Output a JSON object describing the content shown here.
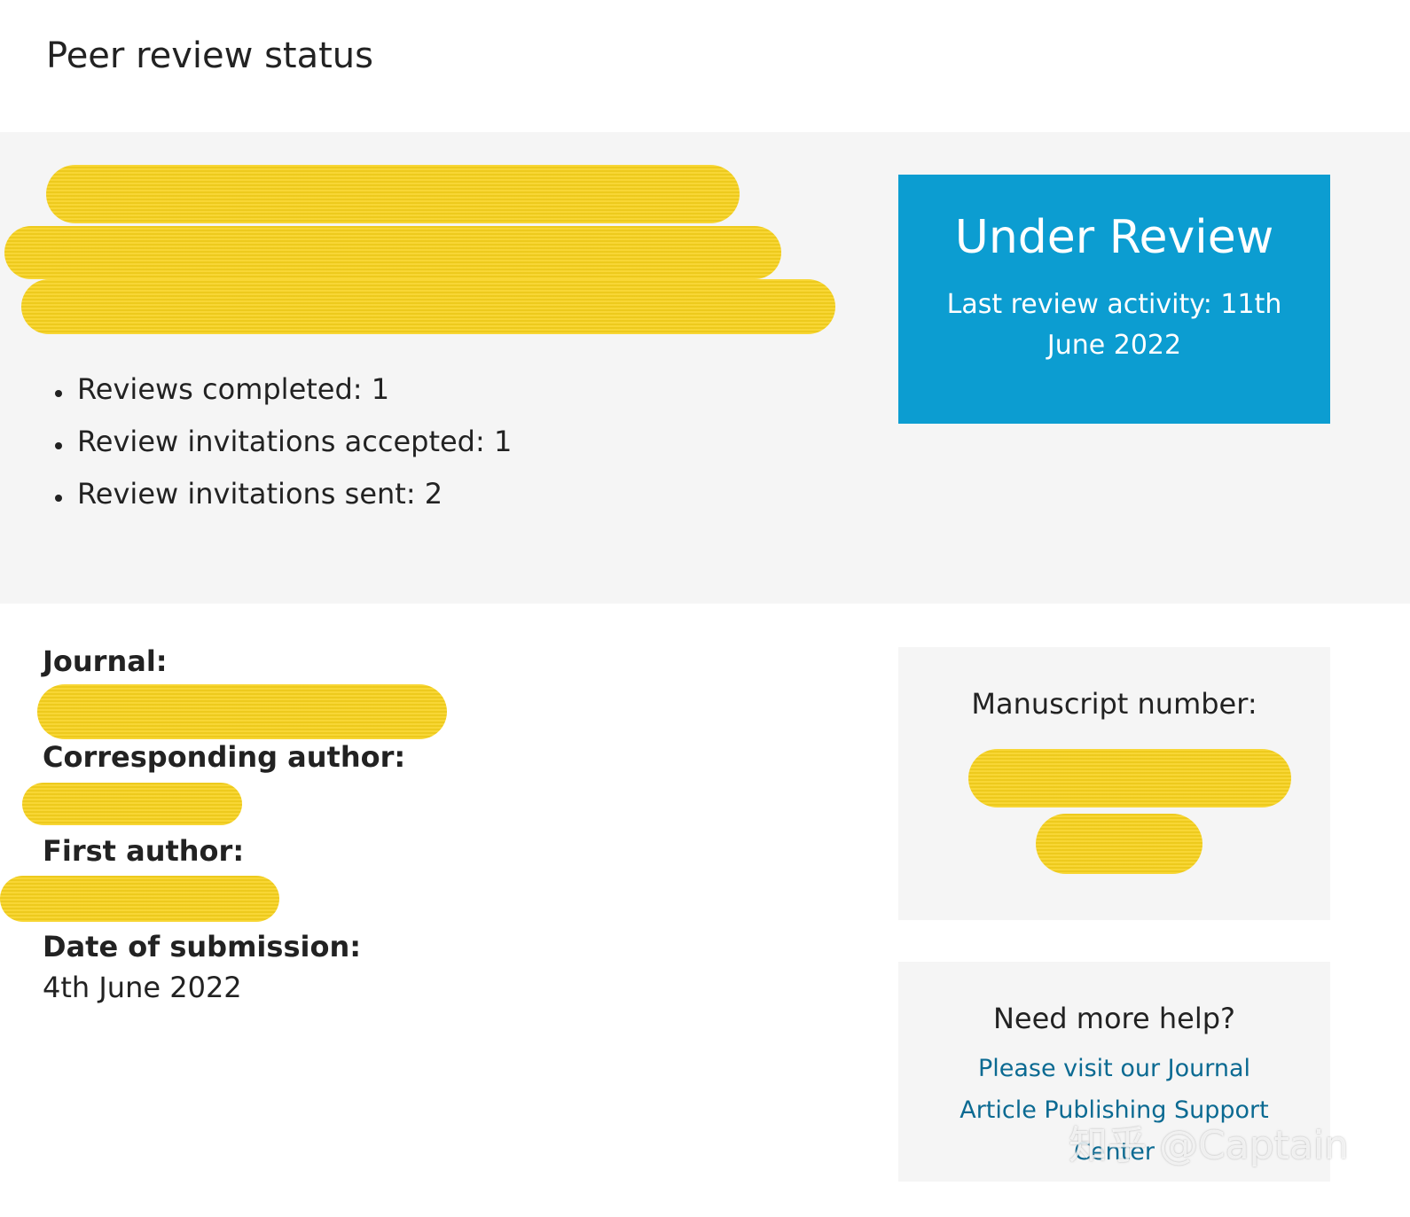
{
  "page": {
    "title": "Peer review status"
  },
  "review_stats": {
    "items": [
      "Reviews completed: 1",
      "Review invitations accepted: 1",
      "Review invitations sent: 2"
    ]
  },
  "status_card": {
    "heading": "Under Review",
    "activity": "Last review activity: 11th June 2022",
    "background_color": "#0c9dd1"
  },
  "details": {
    "journal_label": "Journal:",
    "corresponding_author_label": "Corresponding author:",
    "first_author_label": "First author:",
    "submission_date_label": "Date of submission:",
    "submission_date_value": "4th June 2022"
  },
  "manuscript_card": {
    "heading": "Manuscript number:"
  },
  "help_card": {
    "heading": "Need more help?",
    "link_text": "Please visit our Journal Article Publishing Support Center",
    "link_color": "#0b6a92"
  },
  "redaction_color": "#f7d21e",
  "watermark": {
    "text": "知乎 @Captain"
  }
}
